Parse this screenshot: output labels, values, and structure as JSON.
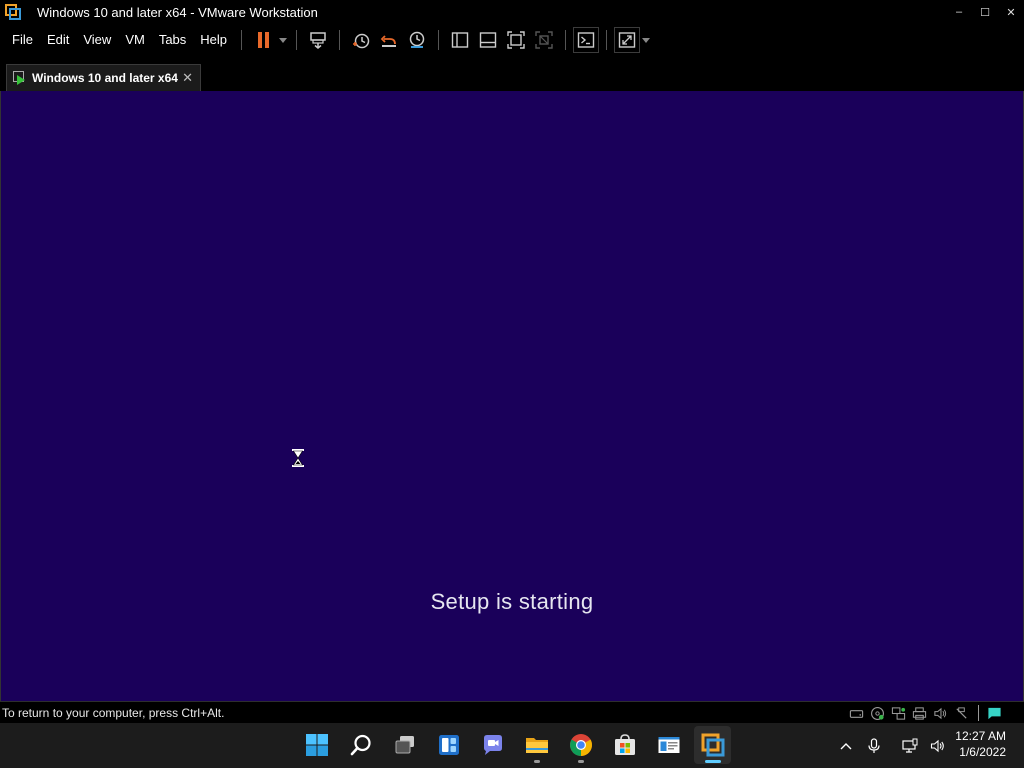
{
  "window": {
    "title": "Windows 10 and later x64 - VMware Workstation",
    "controls": {
      "minimize": "–",
      "maximize": "☐",
      "close": "✕"
    }
  },
  "menu": {
    "items": [
      "File",
      "Edit",
      "View",
      "VM",
      "Tabs",
      "Help"
    ]
  },
  "toolbar": {
    "icons": [
      "pause-icon",
      "send-ctrl-alt-del-icon",
      "snapshot-icon",
      "revert-snapshot-icon",
      "snapshot-manager-icon",
      "show-library-icon",
      "thumbnail-bar-icon",
      "full-screen-icon",
      "unity-icon",
      "console-view-icon",
      "stretch-guest-icon"
    ]
  },
  "tab": {
    "label": "Windows 10 and later x64",
    "close": "✕"
  },
  "vm_screen": {
    "message": "Setup is starting",
    "background": "#1a005a"
  },
  "statusbar": {
    "text": "To return to your computer, press Ctrl+Alt.",
    "icons": [
      "hard-disk-icon",
      "cd-dvd-icon",
      "network-icon",
      "printer-icon",
      "sound-icon",
      "message-icon"
    ]
  },
  "taskbar": {
    "apps": [
      "windows-start-icon",
      "search-icon",
      "task-view-icon",
      "widgets-icon",
      "teams-chat-icon",
      "file-explorer-icon",
      "chrome-icon",
      "microsoft-store-icon",
      "settings-window-icon",
      "vmware-icon"
    ],
    "clock": {
      "time": "12:27 AM",
      "date": "1/6/2022"
    }
  },
  "colors": {
    "accent": "#60cdff",
    "pause": "#e8692a",
    "vmware_orange": "#f0a22a",
    "vmware_blue": "#3a9ad9"
  }
}
